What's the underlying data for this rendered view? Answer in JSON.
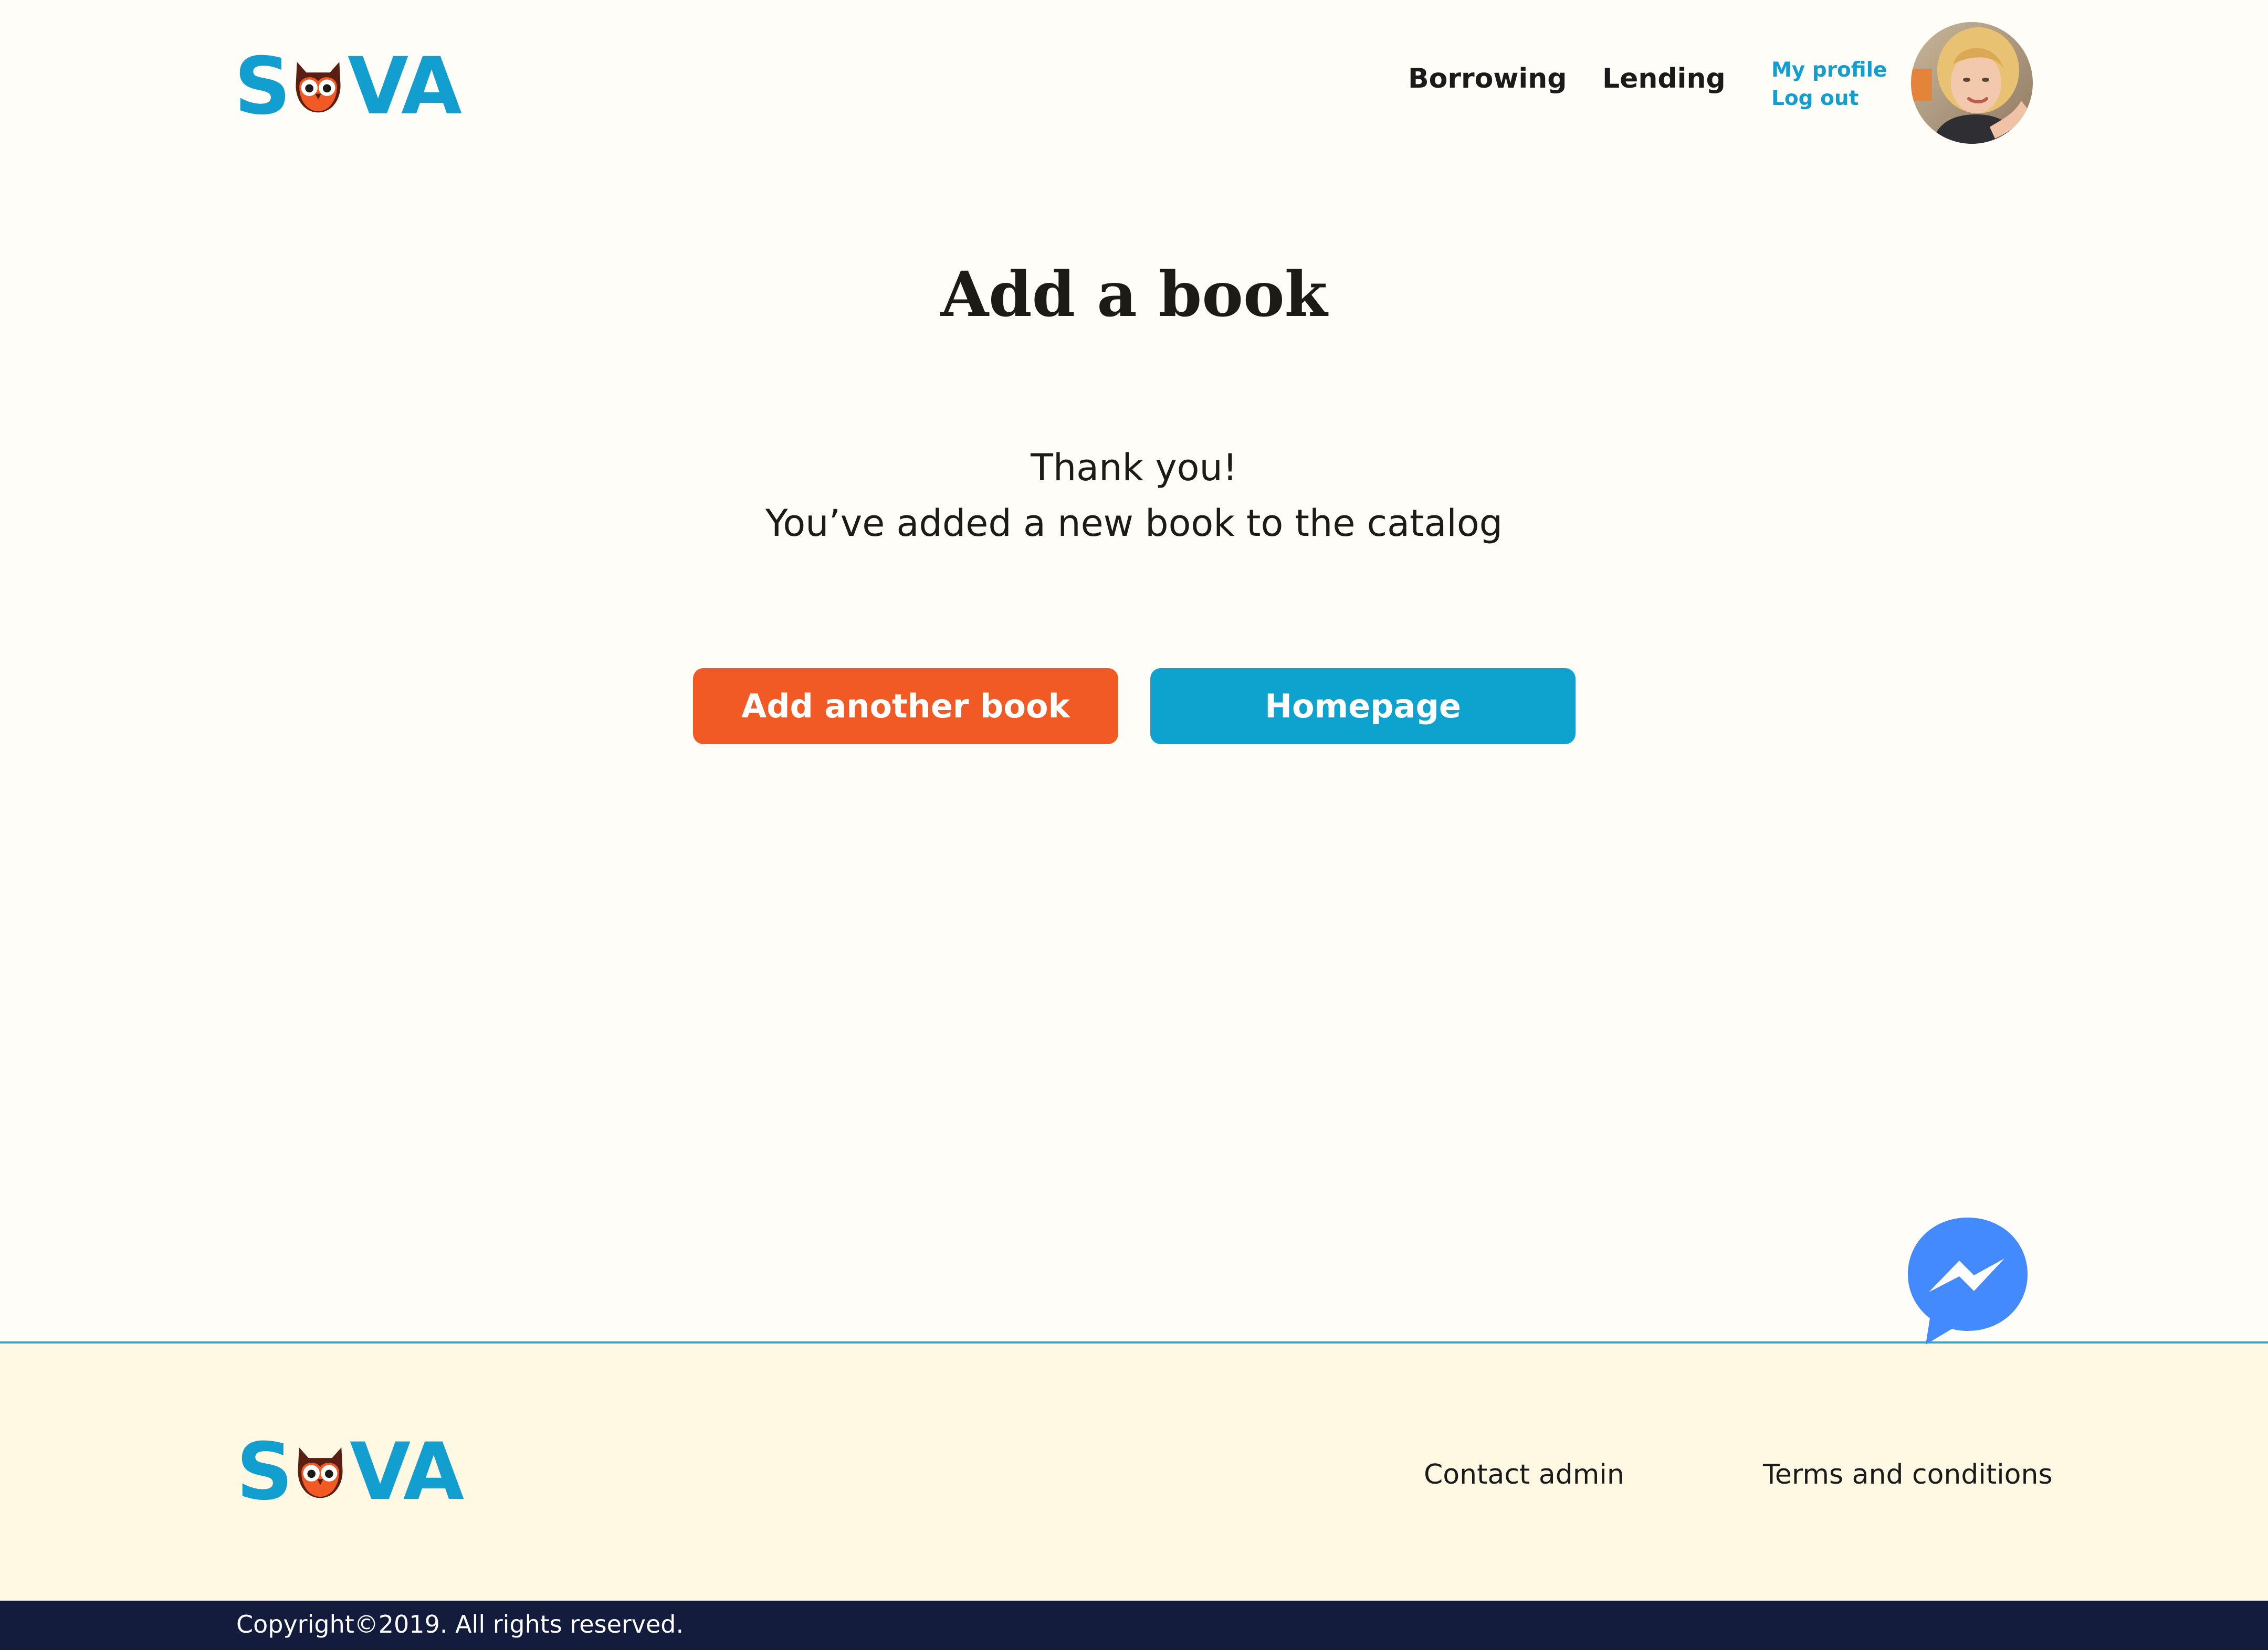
{
  "brand": {
    "logo_text_start": "S",
    "logo_text_end": "VA",
    "primary_color": "#129fcf",
    "accent_color": "#f15a24"
  },
  "header": {
    "nav": {
      "borrowing": "Borrowing",
      "lending": "Lending"
    },
    "account": {
      "my_profile": "My profile",
      "log_out": "Log out"
    }
  },
  "main": {
    "title": "Add a book",
    "message_line1": "Thank you!",
    "message_line2": "You’ve added a new book to the catalog",
    "buttons": {
      "add_another": "Add another book",
      "homepage": "Homepage"
    }
  },
  "footer": {
    "contact_admin": "Contact admin",
    "terms": "Terms and conditions",
    "copyright": "Copyright©2019. All rights reserved."
  },
  "icons": {
    "logo_owl": "owl-icon",
    "messenger": "messenger-icon"
  }
}
